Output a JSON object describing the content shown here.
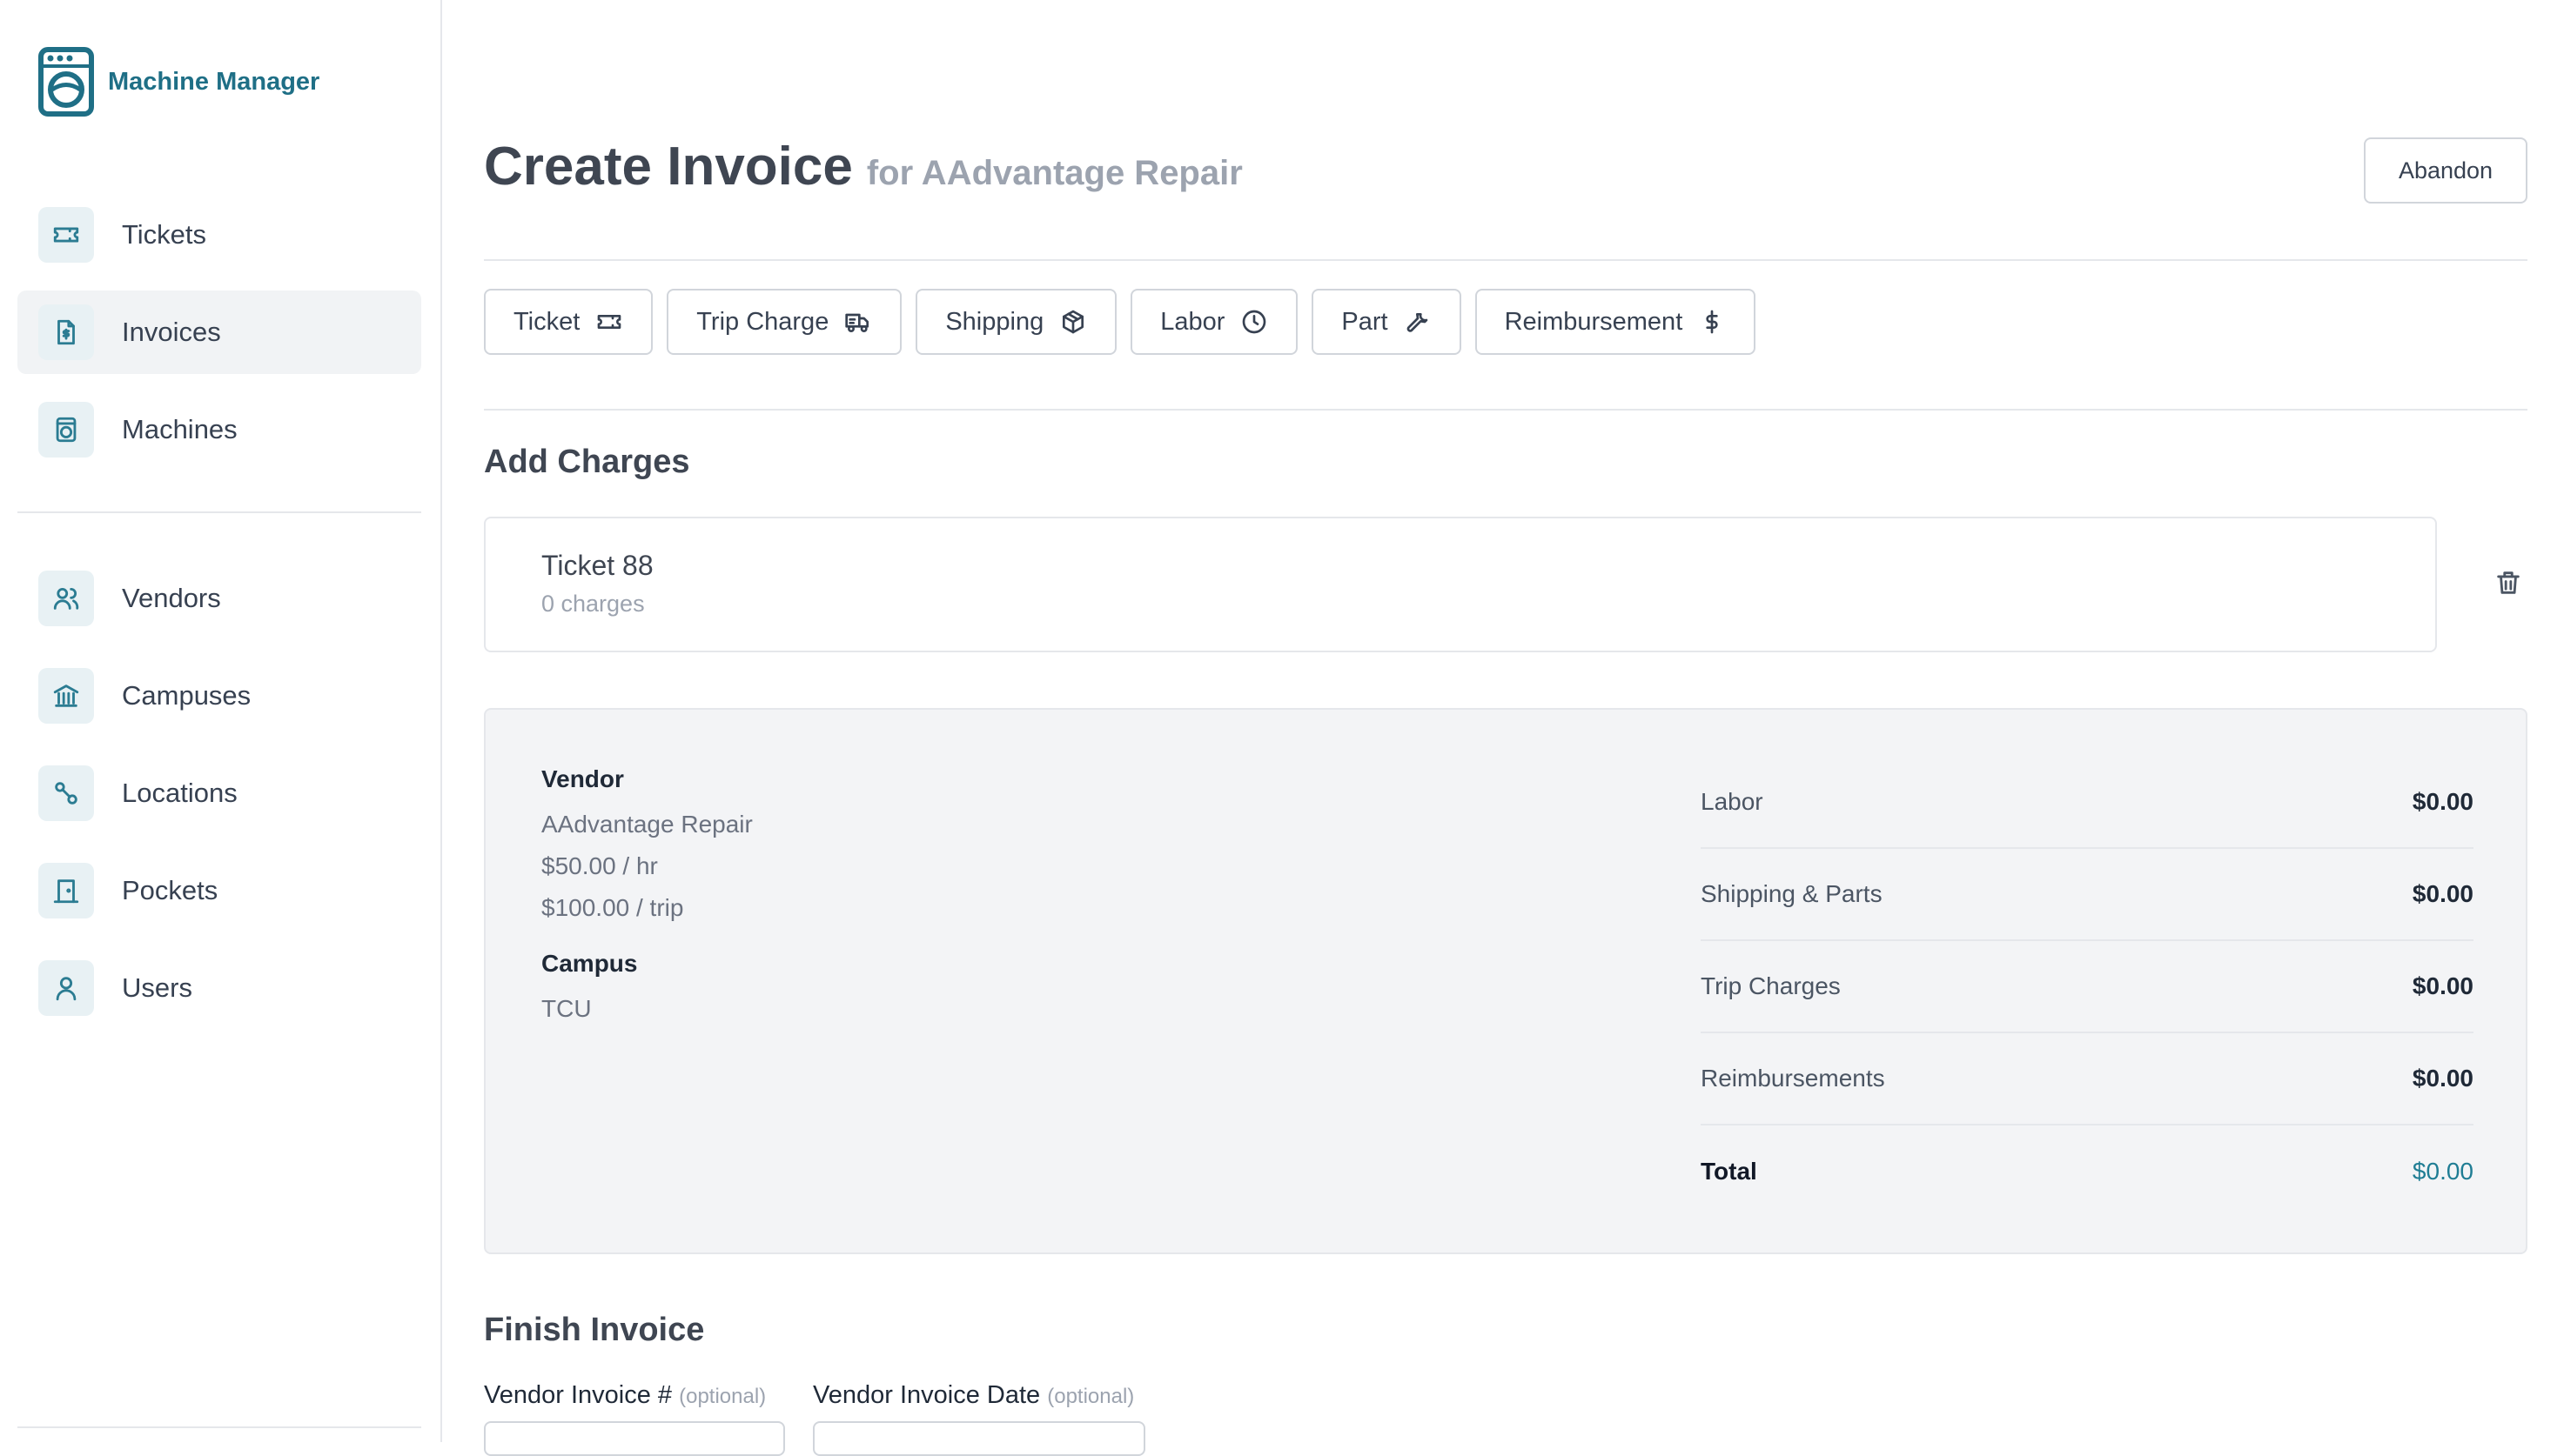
{
  "app": {
    "name": "Machine Manager"
  },
  "sidebar": {
    "primary": [
      {
        "label": "Tickets",
        "icon": "ticket-icon",
        "active": false
      },
      {
        "label": "Invoices",
        "icon": "invoice-dollar-icon",
        "active": true
      },
      {
        "label": "Machines",
        "icon": "washing-machine-icon",
        "active": false
      }
    ],
    "secondary": [
      {
        "label": "Vendors",
        "icon": "users-icon"
      },
      {
        "label": "Campuses",
        "icon": "building-icon"
      },
      {
        "label": "Locations",
        "icon": "route-pin-icon"
      },
      {
        "label": "Pockets",
        "icon": "door-icon"
      },
      {
        "label": "Users",
        "icon": "user-icon"
      }
    ]
  },
  "header": {
    "title": "Create Invoice",
    "subtitle": "for AAdvantage Repair",
    "abandon_label": "Abandon"
  },
  "charge_types": [
    {
      "label": "Ticket",
      "icon": "ticket-icon"
    },
    {
      "label": "Trip Charge",
      "icon": "truck-icon"
    },
    {
      "label": "Shipping",
      "icon": "package-icon"
    },
    {
      "label": "Labor",
      "icon": "clock-icon"
    },
    {
      "label": "Part",
      "icon": "wrench-icon"
    },
    {
      "label": "Reimbursement",
      "icon": "dollar-icon"
    }
  ],
  "add_charges": {
    "heading": "Add Charges",
    "ticket": {
      "title": "Ticket 88",
      "charges": "0 charges"
    }
  },
  "summary": {
    "vendor_label": "Vendor",
    "vendor_name": "AAdvantage Repair",
    "hourly_rate": "$50.00 / hr",
    "trip_rate": "$100.00 / trip",
    "campus_label": "Campus",
    "campus_name": "TCU",
    "totals": [
      {
        "label": "Labor",
        "value": "$0.00"
      },
      {
        "label": "Shipping & Parts",
        "value": "$0.00"
      },
      {
        "label": "Trip Charges",
        "value": "$0.00"
      },
      {
        "label": "Reimbursements",
        "value": "$0.00"
      },
      {
        "label": "Total",
        "value": "$0.00"
      }
    ]
  },
  "finish": {
    "heading": "Finish Invoice",
    "vendor_invoice_number_label": "Vendor Invoice #",
    "vendor_invoice_date_label": "Vendor Invoice Date",
    "optional_tag": "(optional)"
  },
  "colors": {
    "brand": "#1f6f86",
    "accent": "#1f7d94",
    "panel": "#f3f4f6"
  }
}
